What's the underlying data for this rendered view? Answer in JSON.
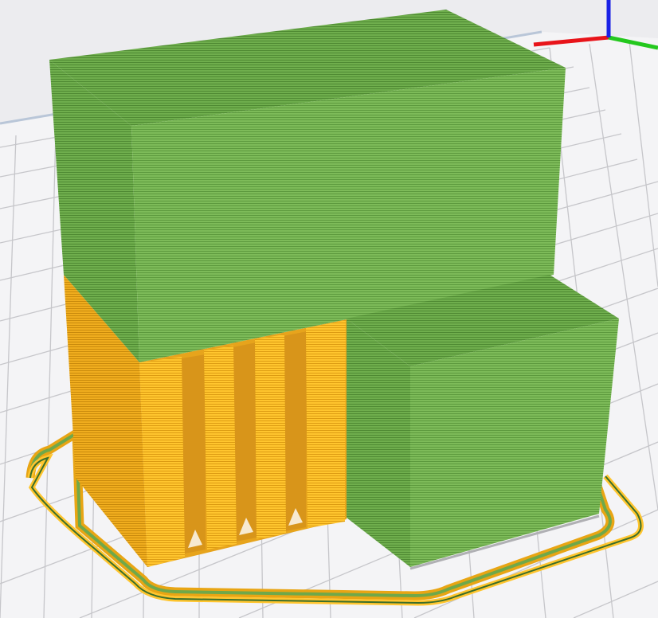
{
  "viewport": {
    "view": "3d-layer-preview",
    "background": "#ececef",
    "build_plate_color": "#f4f4f6",
    "grid_color": "#c6c6ca"
  },
  "axes": {
    "x_color": "#e8141a",
    "y_color": "#24c81e",
    "z_color": "#1a22e6"
  },
  "colors": {
    "support_yellow": "#ffc02a",
    "support_yellow_dark": "#e8a514",
    "model_green": "#7cbc58",
    "model_green_dark": "#5c9a3c"
  }
}
